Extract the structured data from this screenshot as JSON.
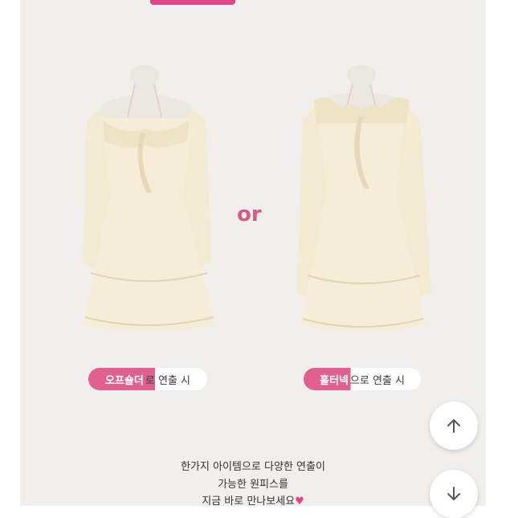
{
  "options": {
    "or_text": "or",
    "left_label_highlight": "오프숄더",
    "left_label_rest": "로 연출 시",
    "right_label_highlight": "홀터넥",
    "right_label_rest": "으로 연출 시"
  },
  "caption": {
    "line1": "한가지 아이템으로 다양한 연출이",
    "line2": "가능한 원피스를",
    "line3": "지금 바로 만나보세요",
    "heart": "♥"
  },
  "colors": {
    "accent": "#e0448a",
    "pill": "#e0608f",
    "panel": "#f1eeec",
    "dress": "#f4ecd6"
  },
  "icons": {
    "scroll_up": "arrow-up-icon",
    "scroll_down": "arrow-down-icon"
  }
}
